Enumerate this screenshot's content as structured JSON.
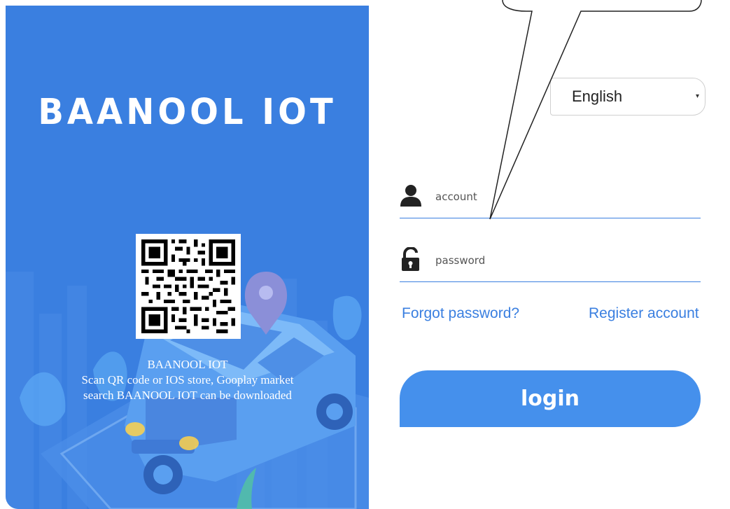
{
  "brand": {
    "title": "BAANOOL IOT"
  },
  "qr": {
    "caption_title": "BAANOOL IOT",
    "caption_line1": "Scan QR code or IOS store, Gooplay market",
    "caption_line2": "search BAANOOL IOT can be downloaded"
  },
  "language": {
    "selected": "English",
    "arrow": "▾"
  },
  "login_form": {
    "account_placeholder": "account",
    "password_placeholder": "password",
    "forgot_label": "Forgot password?",
    "register_label": "Register account",
    "login_label": "login"
  },
  "icons": {
    "account": "user-icon",
    "password": "unlock-icon",
    "language": "chevron-down-icon"
  },
  "colors": {
    "primary": "#3a7fe0",
    "button": "#4590ec",
    "panel_text": "#ffffff"
  }
}
